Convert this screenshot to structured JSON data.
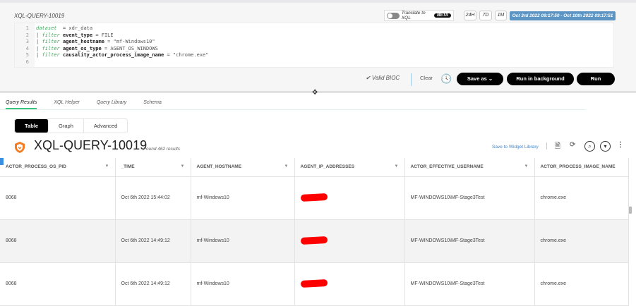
{
  "query": {
    "title": "XQL-QUERY-10019",
    "lines": [
      {
        "n": "1",
        "kw": "dataset",
        "rest": " = xdr_data",
        "field": ""
      },
      {
        "n": "2",
        "kw": "filter",
        "field": "event_type",
        "rest": " = FILE"
      },
      {
        "n": "3",
        "kw": "filter",
        "field": "agent_hostname",
        "rest": " = \"mf-Windows10\""
      },
      {
        "n": "4",
        "kw": "filter",
        "field": "agent_os_type",
        "rest": " = AGENT_OS_WINDOWS"
      },
      {
        "n": "5",
        "kw": "filter",
        "field": "causality_actor_process_image_name",
        "rest": " = \"chrome.exe\""
      },
      {
        "n": "6",
        "kw": "",
        "field": "",
        "rest": ""
      }
    ]
  },
  "toolbar": {
    "translate": "Translate to XQL",
    "beta": "BETA",
    "r24": "24H",
    "r7": "7D",
    "r1m": "1M",
    "date_range": "Oct 3rd 2022 09:17:50 - Oct 10th 2022 09:17:51",
    "valid": "✔ Valid BIOC",
    "clear": "Clear",
    "save_as": "Save as ⌄",
    "run_bg": "Run in background",
    "run": "Run"
  },
  "tabs": [
    "Query Results",
    "XQL Helper",
    "Query Library",
    "Schema"
  ],
  "views": [
    "Table",
    "Graph",
    "Advanced"
  ],
  "results": {
    "title": "XQL-QUERY-10019",
    "found": "Found 462 results",
    "save_widget": "Save to Widget Library"
  },
  "table": {
    "columns": [
      "ACTOR_PROCESS_OS_PID",
      "_TIME",
      "AGENT_HOSTNAME",
      "AGENT_IP_ADDRESSES",
      "ACTOR_EFFECTIVE_USERNAME",
      "ACTOR_PROCESS_IMAGE_NAME"
    ],
    "rows": [
      [
        "8068",
        "Oct 6th 2022 15:44:02",
        "mf-Windows10",
        "",
        "MF-WINDOWS10\\MF-Stage3Test",
        "chrome.exe"
      ],
      [
        "8068",
        "Oct 6th 2022 14:49:12",
        "mf-Windows10",
        "",
        "MF-WINDOWS10\\MF-Stage3Test",
        "chrome.exe"
      ],
      [
        "8068",
        "Oct 6th 2022 14:49:12",
        "mf-Windows10",
        "",
        "MF-WINDOWS10\\MF-Stage3Test",
        "chrome.exe"
      ]
    ]
  }
}
